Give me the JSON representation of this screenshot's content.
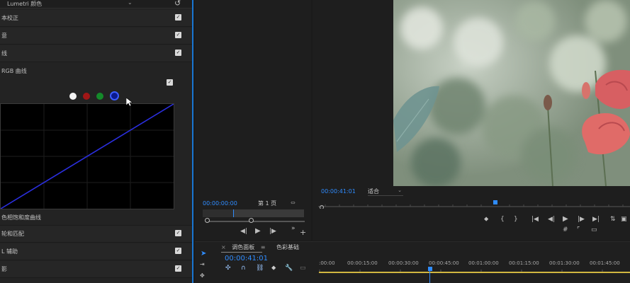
{
  "lumetri": {
    "title": "Lumetri 颜色",
    "dropdown_icon": "chevron-down-icon",
    "reset_icon": "reset-icon",
    "sections": [
      {
        "label": "本校正",
        "checked": true
      },
      {
        "label": "意",
        "checked": true
      },
      {
        "label": "线",
        "checked": true
      }
    ],
    "rgb_curves_label": "RGB 曲线",
    "rgb_checked": true,
    "channel_colors": [
      "#f2f2f2",
      "#a01616",
      "#148a2a",
      "#1f2fd8"
    ],
    "sections_bottom": [
      {
        "label": "色相饱和度曲线",
        "checked": false
      },
      {
        "label": "轮和匹配",
        "checked": true
      },
      {
        "label": "L 辅助",
        "checked": true
      },
      {
        "label": "影",
        "checked": true
      }
    ],
    "accent": "#1976d2"
  },
  "source_monitor": {
    "timecode": "00:00:00:00",
    "page_label": "第 1 页",
    "controls": [
      "◀|",
      "▶",
      "|▶",
      "»",
      "+"
    ]
  },
  "program_monitor": {
    "timecode": "00:00:41:01",
    "fit_label": "适合",
    "playhead_fraction": 0.57
  },
  "timeline": {
    "tabs": [
      {
        "label": "调色面板",
        "active": true
      },
      {
        "label": "色彩基础",
        "active": false
      }
    ],
    "timecode": "00:00:41:01",
    "ticks": [
      ":00:00",
      "00:00:15:00",
      "00:00:30:00",
      "00:00:45:00",
      "00:01:00:00",
      "00:01:15:00",
      "00:01:30:00",
      "00:01:45:00"
    ],
    "playhead_color": "#2f8cff",
    "work_area_color": "#d1b640"
  }
}
